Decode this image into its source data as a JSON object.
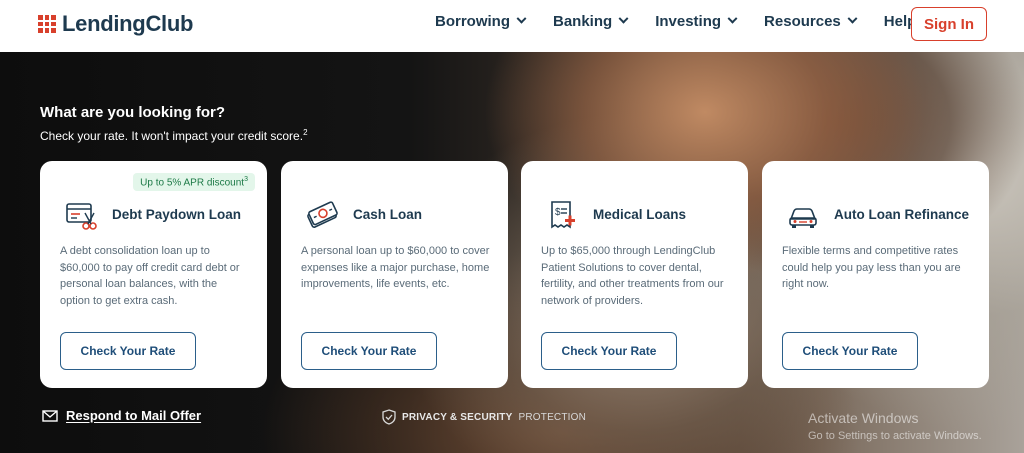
{
  "header": {
    "brand": "LendingClub",
    "nav": [
      "Borrowing",
      "Banking",
      "Investing",
      "Resources",
      "Help"
    ],
    "signin_label": "Sign In"
  },
  "hero": {
    "title": "What are you looking for?",
    "subtitle": "Check your rate. It won't impact your credit score.",
    "subtitle_footnote": "2",
    "cards": [
      {
        "badge": "Up to 5% APR discount",
        "badge_footnote": "3",
        "title": "Debt Paydown Loan",
        "description": "A debt consolidation loan up to $60,000 to pay off credit card debt or personal loan balances, with the option to get extra cash.",
        "button": "Check Your Rate",
        "icon": "debt-paydown-icon"
      },
      {
        "title": "Cash Loan",
        "description": "A personal loan up to $60,000 to cover expenses like a major purchase, home improvements, life events, etc.",
        "button": "Check Your Rate",
        "icon": "cash-icon"
      },
      {
        "title": "Medical Loans",
        "description": "Up to $65,000 through LendingClub Patient Solutions to cover dental, fertility, and other treatments from our network of providers.",
        "button": "Check Your Rate",
        "icon": "medical-bill-icon"
      },
      {
        "title": "Auto Loan Refinance",
        "description": "Flexible terms and competitive rates could help you pay less than you are right now.",
        "button": "Check Your Rate",
        "icon": "car-icon"
      }
    ],
    "mail_offer": "Respond to Mail Offer",
    "privacy_bold": "PRIVACY & SECURITY",
    "privacy_rest": "PROTECTION",
    "watermark_title": "Activate Windows",
    "watermark_sub": "Go to Settings to activate Windows."
  },
  "colors": {
    "brand_red": "#d8402c",
    "navy": "#1e3a4f",
    "button_blue": "#1f4e79",
    "badge_green": "#1d7a47"
  }
}
